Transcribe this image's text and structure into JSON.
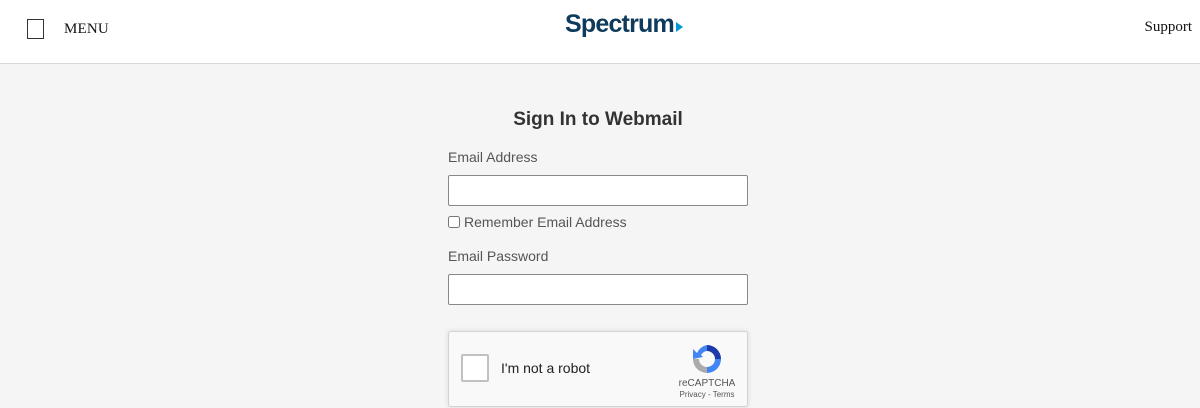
{
  "header": {
    "menu_label": "MENU",
    "logo_text": "Spectrum",
    "support_label": "Support"
  },
  "form": {
    "title": "Sign In to Webmail",
    "email_label": "Email Address",
    "email_value": "",
    "remember_label": "Remember Email Address",
    "remember_checked": false,
    "password_label": "Email Password",
    "password_value": ""
  },
  "recaptcha": {
    "label": "I'm not a robot",
    "brand": "reCAPTCHA",
    "privacy": "Privacy",
    "separator": " - ",
    "terms": "Terms"
  },
  "colors": {
    "brand_navy": "#0e3a5b",
    "brand_blue": "#0099d8",
    "page_bg": "#f5f5f5"
  }
}
